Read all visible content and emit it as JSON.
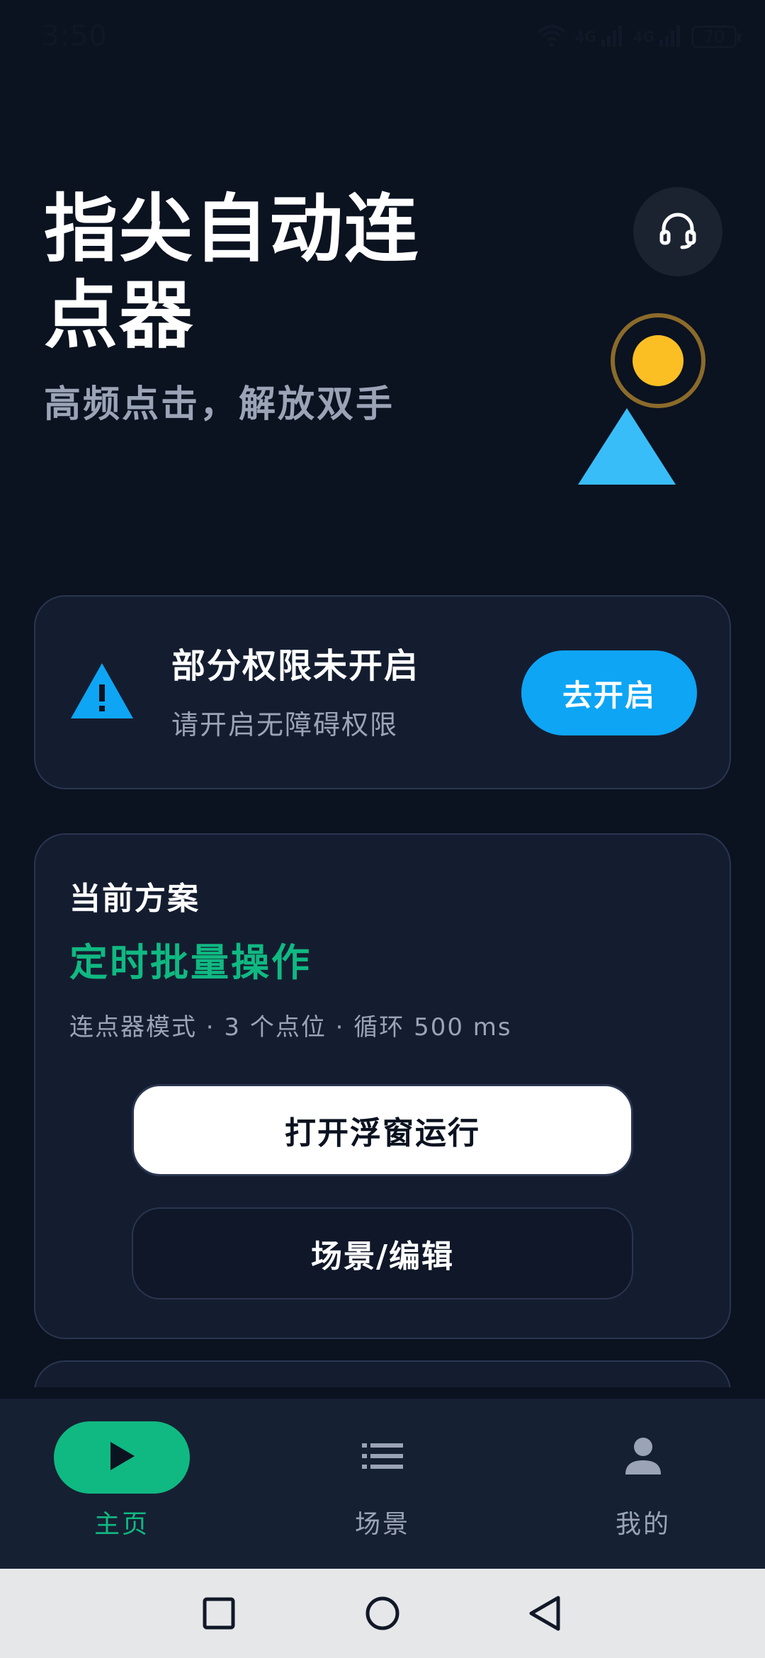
{
  "status_bar": {
    "time": "3:50",
    "network_1": "4G",
    "network_2": "4G",
    "battery": "70"
  },
  "header": {
    "title": "指尖自动连点器",
    "subtitle": "高频点击，解放双手"
  },
  "permission_card": {
    "title": "部分权限未开启",
    "description": "请开启无障碍权限",
    "button_label": "去开启"
  },
  "plan_card": {
    "label": "当前方案",
    "plan_name": "定时批量操作",
    "meta": "连点器模式 · 3 个点位 · 循环 500 ms",
    "open_button": "打开浮窗运行",
    "edit_button": "场景/编辑"
  },
  "bottom_nav": {
    "items": [
      {
        "label": "主页",
        "icon": "play-icon",
        "active": true
      },
      {
        "label": "场景",
        "icon": "list-icon",
        "active": false
      },
      {
        "label": "我的",
        "icon": "person-icon",
        "active": false
      }
    ]
  },
  "colors": {
    "background": "#0b1220",
    "card": "#141d30",
    "accent_green": "#10b981",
    "accent_blue": "#0ea5f5",
    "warning_yellow": "#fbbf24"
  }
}
